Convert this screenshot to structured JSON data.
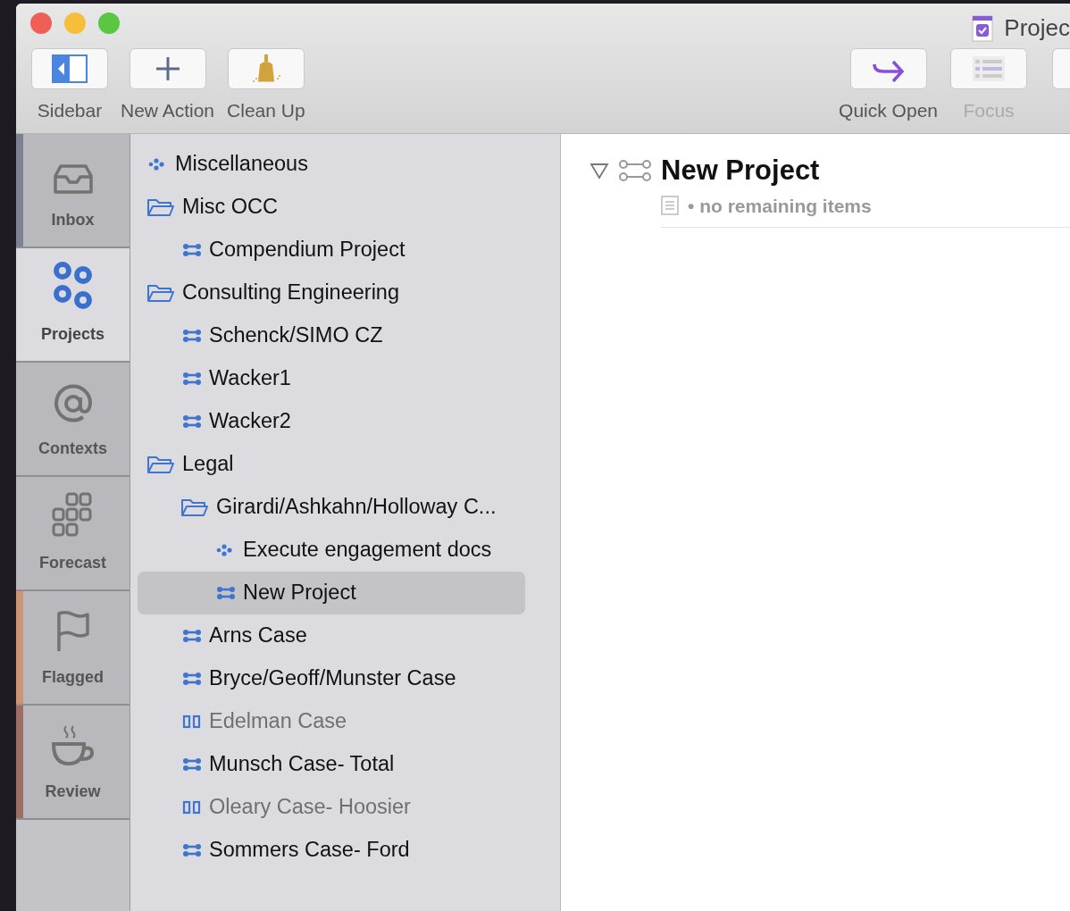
{
  "window": {
    "title": "Projec"
  },
  "toolbar_left": [
    {
      "label": "Sidebar",
      "kind": "sidebar",
      "disabled": false
    },
    {
      "label": "New Action",
      "kind": "add",
      "disabled": false
    },
    {
      "label": "Clean Up",
      "kind": "broom",
      "disabled": false
    }
  ],
  "toolbar_right": [
    {
      "label": "Quick Open",
      "kind": "arrow",
      "disabled": false
    },
    {
      "label": "Focus",
      "kind": "focus",
      "disabled": true
    }
  ],
  "perspectives": [
    {
      "label": "Inbox",
      "kind": "inbox",
      "selected": false,
      "color": "#7c8193"
    },
    {
      "label": "Projects",
      "kind": "projects",
      "selected": true
    },
    {
      "label": "Contexts",
      "kind": "contexts",
      "selected": false
    },
    {
      "label": "Forecast",
      "kind": "forecast",
      "selected": false
    },
    {
      "label": "Flagged",
      "kind": "flagged",
      "selected": false,
      "color": "#c99574"
    },
    {
      "label": "Review",
      "kind": "review",
      "selected": false,
      "color": "#9e6e63"
    }
  ],
  "projects": [
    {
      "label": "Miscellaneous",
      "kind": "single-actions",
      "on_hold": false,
      "selected": false
    },
    {
      "label": "Misc OCC",
      "kind": "folder",
      "on_hold": false,
      "selected": false,
      "children": [
        {
          "label": "Compendium Project",
          "kind": "project",
          "on_hold": false,
          "selected": false
        }
      ]
    },
    {
      "label": "Consulting Engineering",
      "kind": "folder",
      "on_hold": false,
      "selected": false,
      "children": [
        {
          "label": "Schenck/SIMO CZ",
          "kind": "project",
          "on_hold": false,
          "selected": false
        },
        {
          "label": "Wacker1",
          "kind": "project",
          "on_hold": false,
          "selected": false
        },
        {
          "label": "Wacker2",
          "kind": "project",
          "on_hold": false,
          "selected": false
        }
      ]
    },
    {
      "label": "Legal",
      "kind": "folder",
      "on_hold": false,
      "selected": false,
      "children": [
        {
          "label": "Girardi/Ashkahn/Holloway C...",
          "kind": "folder",
          "on_hold": false,
          "selected": false,
          "children": [
            {
              "label": "Execute engagement docs",
              "kind": "single-actions",
              "on_hold": false,
              "selected": false
            },
            {
              "label": "New Project",
              "kind": "project",
              "on_hold": false,
              "selected": true
            }
          ]
        },
        {
          "label": "Arns Case",
          "kind": "project",
          "on_hold": false,
          "selected": false
        },
        {
          "label": "Bryce/Geoff/Munster Case",
          "kind": "project",
          "on_hold": false,
          "selected": false
        },
        {
          "label": "Edelman Case",
          "kind": "project",
          "on_hold": true,
          "selected": false
        },
        {
          "label": "Munsch Case- Total",
          "kind": "project",
          "on_hold": false,
          "selected": false
        },
        {
          "label": "Oleary Case- Hoosier",
          "kind": "project",
          "on_hold": true,
          "selected": false
        },
        {
          "label": "Sommers Case- Ford",
          "kind": "project",
          "on_hold": false,
          "selected": false
        }
      ]
    }
  ],
  "detail": {
    "title": "New Project",
    "expanded": true,
    "status": "• no remaining items"
  }
}
